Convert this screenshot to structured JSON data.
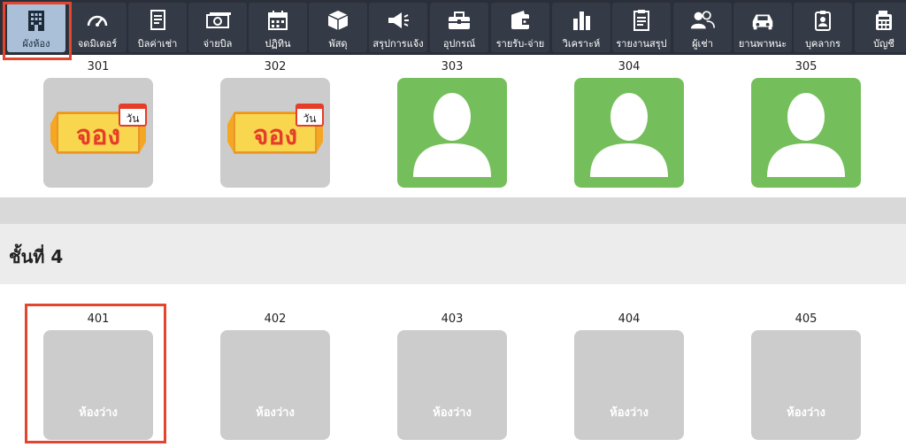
{
  "toolbar": {
    "items": [
      {
        "label": "ผังห้อง",
        "icon": "building-icon",
        "active": true
      },
      {
        "label": "จดมิเตอร์",
        "icon": "gauge-icon",
        "active": false
      },
      {
        "label": "บิลค่าเช่า",
        "icon": "document-icon",
        "active": false
      },
      {
        "label": "จ่ายบิล",
        "icon": "cash-icon",
        "active": false
      },
      {
        "label": "ปฏิทิน",
        "icon": "calendar-icon",
        "active": false
      },
      {
        "label": "พัสดุ",
        "icon": "package-icon",
        "active": false
      },
      {
        "label": "สรุปการแจ้ง",
        "icon": "megaphone-icon",
        "active": false
      },
      {
        "label": "อุปกรณ์",
        "icon": "toolbox-icon",
        "active": false
      },
      {
        "label": "รายรับ-จ่าย",
        "icon": "wallet-icon",
        "active": false
      },
      {
        "label": "วิเคราะห์",
        "icon": "bar-chart-icon",
        "active": false
      },
      {
        "label": "รายงานสรุป",
        "icon": "clipboard-icon",
        "active": false
      },
      {
        "label": "ผู้เช่า",
        "icon": "users-icon",
        "active": false
      },
      {
        "label": "ยานพาหนะ",
        "icon": "car-icon",
        "active": false
      },
      {
        "label": "บุคลากร",
        "icon": "staff-badge-icon",
        "active": false
      },
      {
        "label": "บัญชี",
        "icon": "calculator-icon",
        "active": false
      }
    ]
  },
  "floor3": {
    "rooms": [
      {
        "number": "301",
        "status": "reserved",
        "badge_text": "จอง",
        "tag_text": "วัน"
      },
      {
        "number": "302",
        "status": "reserved",
        "badge_text": "จอง",
        "tag_text": "วัน"
      },
      {
        "number": "303",
        "status": "occupied"
      },
      {
        "number": "304",
        "status": "occupied"
      },
      {
        "number": "305",
        "status": "occupied"
      }
    ]
  },
  "floor4": {
    "title": "ชั้นที่ 4",
    "rooms": [
      {
        "number": "401",
        "status": "vacant",
        "label": "ห้องว่าง"
      },
      {
        "number": "402",
        "status": "vacant",
        "label": "ห้องว่าง"
      },
      {
        "number": "403",
        "status": "vacant",
        "label": "ห้องว่าง"
      },
      {
        "number": "404",
        "status": "vacant",
        "label": "ห้องว่าง"
      },
      {
        "number": "405",
        "status": "vacant",
        "label": "ห้องว่าง"
      }
    ]
  },
  "colors": {
    "toolbar_bg": "#2a2f3a",
    "active_tab": "#a9c0d8",
    "occupied_green": "#74bf5c",
    "vacant_gray": "#cccccc",
    "highlight_red": "#e2462f"
  }
}
